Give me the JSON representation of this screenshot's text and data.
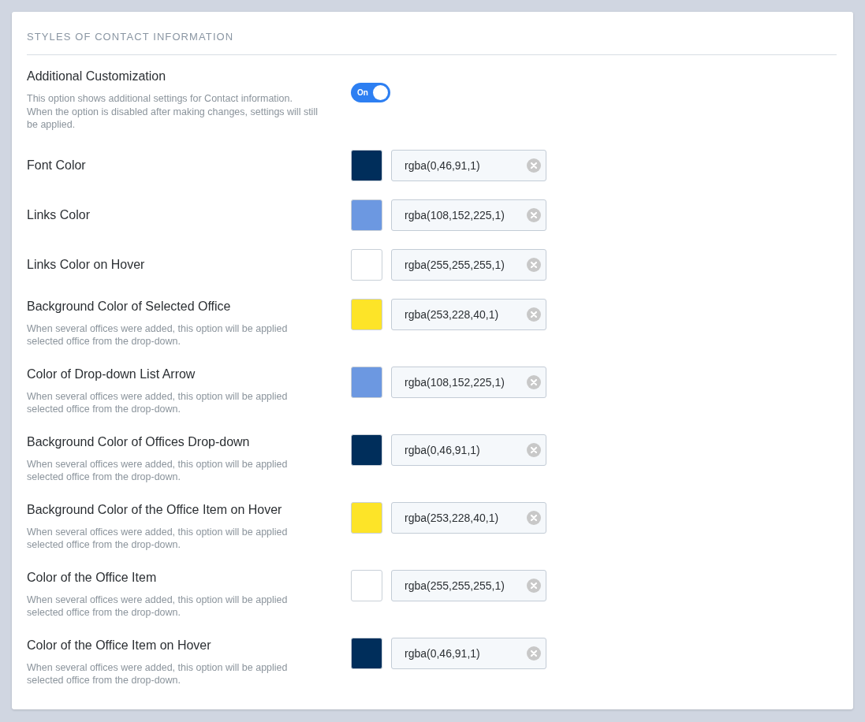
{
  "section": {
    "title": "STYLES OF CONTACT INFORMATION"
  },
  "toggle_setting": {
    "label": "Additional Customization",
    "description": "This option shows additional settings for Contact information. When the option is disabled after making changes, settings will still be applied.",
    "on": true,
    "state_label": "On"
  },
  "color_settings": [
    {
      "label": "Font Color",
      "value": "rgba(0,46,91,1)",
      "color": "#002e5b"
    },
    {
      "label": "Links Color",
      "value": "rgba(108,152,225,1)",
      "color": "#6c98e1"
    },
    {
      "label": "Links Color on Hover",
      "value": "rgba(255,255,255,1)",
      "color": "#ffffff"
    },
    {
      "label": "Background Color of Selected Office",
      "description": "When several offices were added, this option will be applied selected office from the drop-down.",
      "value": "rgba(253,228,40,1)",
      "color": "#fde428"
    },
    {
      "label": "Color of Drop-down List Arrow",
      "description": "When several offices were added, this option will be applied selected office from the drop-down.",
      "value": "rgba(108,152,225,1)",
      "color": "#6c98e1"
    },
    {
      "label": "Background Color of Offices Drop-down",
      "description": "When several offices were added, this option will be applied selected office from the drop-down.",
      "value": "rgba(0,46,91,1)",
      "color": "#002e5b"
    },
    {
      "label": "Background Color of the Office Item on Hover",
      "description": "When several offices were added, this option will be applied selected office from the drop-down.",
      "value": "rgba(253,228,40,1)",
      "color": "#fde428"
    },
    {
      "label": "Color of the Office Item",
      "description": "When several offices were added, this option will be applied selected office from the drop-down.",
      "value": "rgba(255,255,255,1)",
      "color": "#ffffff"
    },
    {
      "label": "Color of the Office Item on Hover",
      "description": "When several offices were added, this option will be applied selected office from the drop-down.",
      "value": "rgba(0,46,91,1)",
      "color": "#002e5b"
    }
  ]
}
